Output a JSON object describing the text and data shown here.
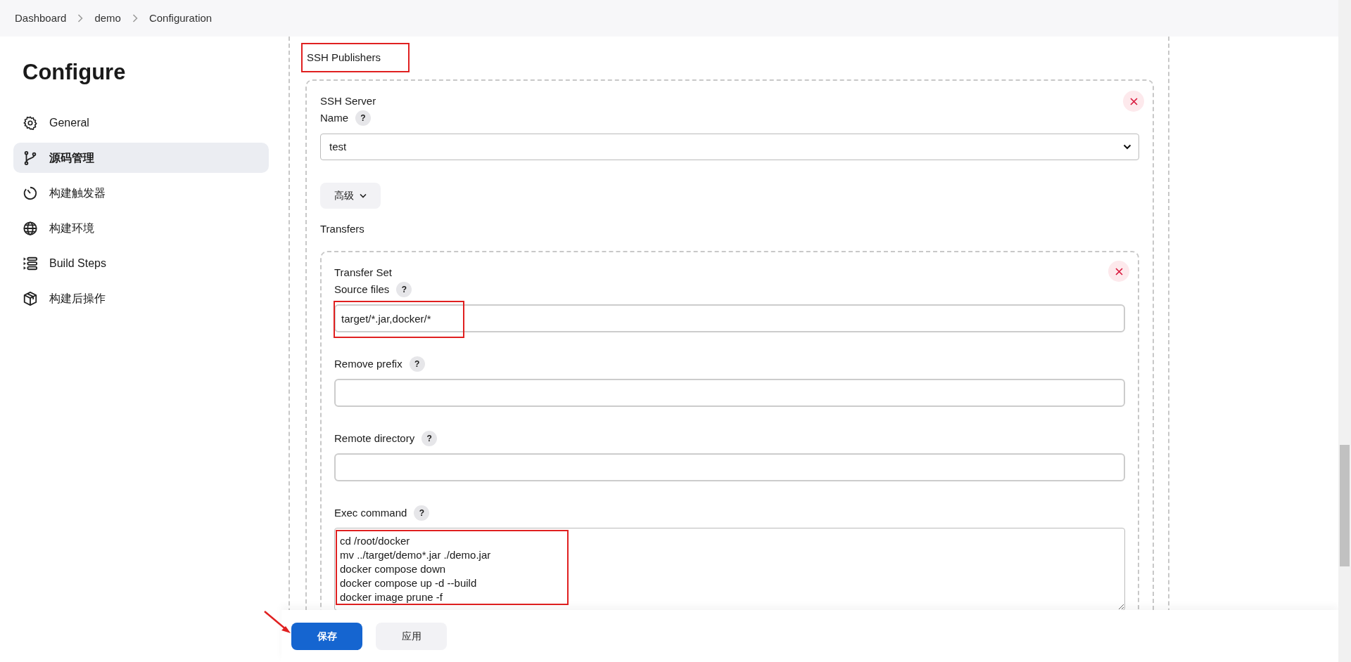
{
  "breadcrumbs": [
    "Dashboard",
    "demo",
    "Configuration"
  ],
  "page_title": "Configure",
  "sidebar": {
    "items": [
      {
        "label": "General",
        "selected": false
      },
      {
        "label": "源码管理",
        "selected": true
      },
      {
        "label": "构建触发器",
        "selected": false
      },
      {
        "label": "构建环境",
        "selected": false
      },
      {
        "label": "Build Steps",
        "selected": false
      },
      {
        "label": "构建后操作",
        "selected": false
      }
    ]
  },
  "section": {
    "title": "SSH Publishers",
    "highlighted": true
  },
  "ssh_server": {
    "heading": "SSH Server",
    "name_label": "Name",
    "help": "?",
    "name_value": "test",
    "advanced_button": "高级",
    "transfers_label": "Transfers",
    "transfer_set": {
      "heading": "Transfer Set",
      "fields": [
        {
          "kind": "input",
          "label": "Source files",
          "help": "?",
          "value": "target/*.jar,docker/*",
          "highlighted": true
        },
        {
          "kind": "input",
          "label": "Remove prefix",
          "help": "?",
          "highlighted": false
        },
        {
          "kind": "input",
          "label": "Remote directory",
          "help": "?",
          "highlighted": false
        },
        {
          "kind": "textarea",
          "label": "Exec command",
          "help": "?",
          "value": "cd /root/docker\nmv ../target/demo*.jar ./demo.jar\ndocker compose down\ndocker compose up -d --build\ndocker image prune -f",
          "highlighted": true
        }
      ]
    }
  },
  "buttons": [
    {
      "label": "保存",
      "kind": "primary",
      "arrow": true
    },
    {
      "label": "应用",
      "kind": "secondary",
      "arrow": false
    }
  ]
}
